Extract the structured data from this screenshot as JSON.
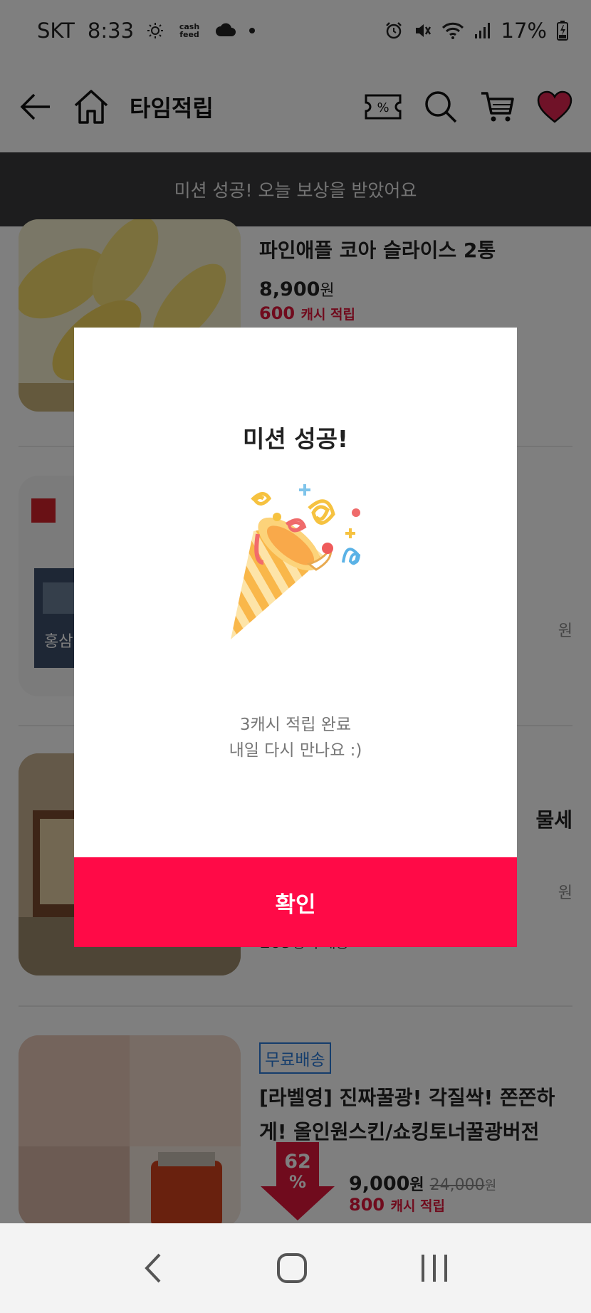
{
  "status_bar": {
    "carrier": "SKT",
    "time": "8:33",
    "cashfeed_label": "cash feed",
    "battery": "17%"
  },
  "app_bar": {
    "title": "타임적립"
  },
  "banner": {
    "text": "미션 성공! 오늘 보상을 받았어요"
  },
  "products": [
    {
      "name": "파인애플 코아 슬라이스 2통",
      "price": "8,900",
      "price_unit": "원",
      "cash": "600",
      "cash_suffix": "캐시 적립"
    },
    {
      "price_fragment": "원",
      "brand_text": "홍삼"
    },
    {
      "name_fragment": "물세",
      "price_fragment": "원",
      "discount_shape": "down-arrow",
      "buyers": "109",
      "buyers_suffix": "명 구매중"
    },
    {
      "badge": "무료배송",
      "name": "[라벨영] 진짜꿀광! 각질싹! 쫀쫀하게! 올인원스킨/쇼킹토너꿀광버전",
      "discount": "62",
      "discount_unit": "%",
      "price": "9,000",
      "price_unit": "원",
      "original_price": "24,000",
      "original_unit": "원",
      "cash": "800",
      "cash_suffix": "캐시 적립"
    }
  ],
  "modal": {
    "title": "미션 성공!",
    "message_line1": "3캐시 적립 완료",
    "message_line2": "내일 다시 만나요 :)",
    "confirm_label": "확인"
  },
  "colors": {
    "accent": "#ff0a47",
    "cash_red": "#e0173b",
    "banner_bg": "#3a3a3c",
    "free_ship_blue": "#2b7bd8"
  }
}
